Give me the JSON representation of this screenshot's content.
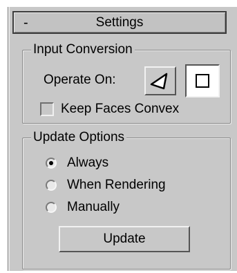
{
  "rollout": {
    "collapse_symbol": "-",
    "title": "Settings"
  },
  "input_conversion": {
    "group_title": "Input Conversion",
    "operate_on_label": "Operate On:",
    "operate_on_buttons": [
      {
        "icon": "triangle-face-icon",
        "state": "unpressed"
      },
      {
        "icon": "square-polygon-icon",
        "state": "pressed"
      }
    ],
    "keep_faces_convex": {
      "label": "Keep Faces Convex",
      "checked": false
    }
  },
  "update_options": {
    "group_title": "Update Options",
    "options": [
      {
        "label": "Always",
        "selected": true
      },
      {
        "label": "When Rendering",
        "selected": false
      },
      {
        "label": "Manually",
        "selected": false
      }
    ],
    "update_button": "Update"
  }
}
